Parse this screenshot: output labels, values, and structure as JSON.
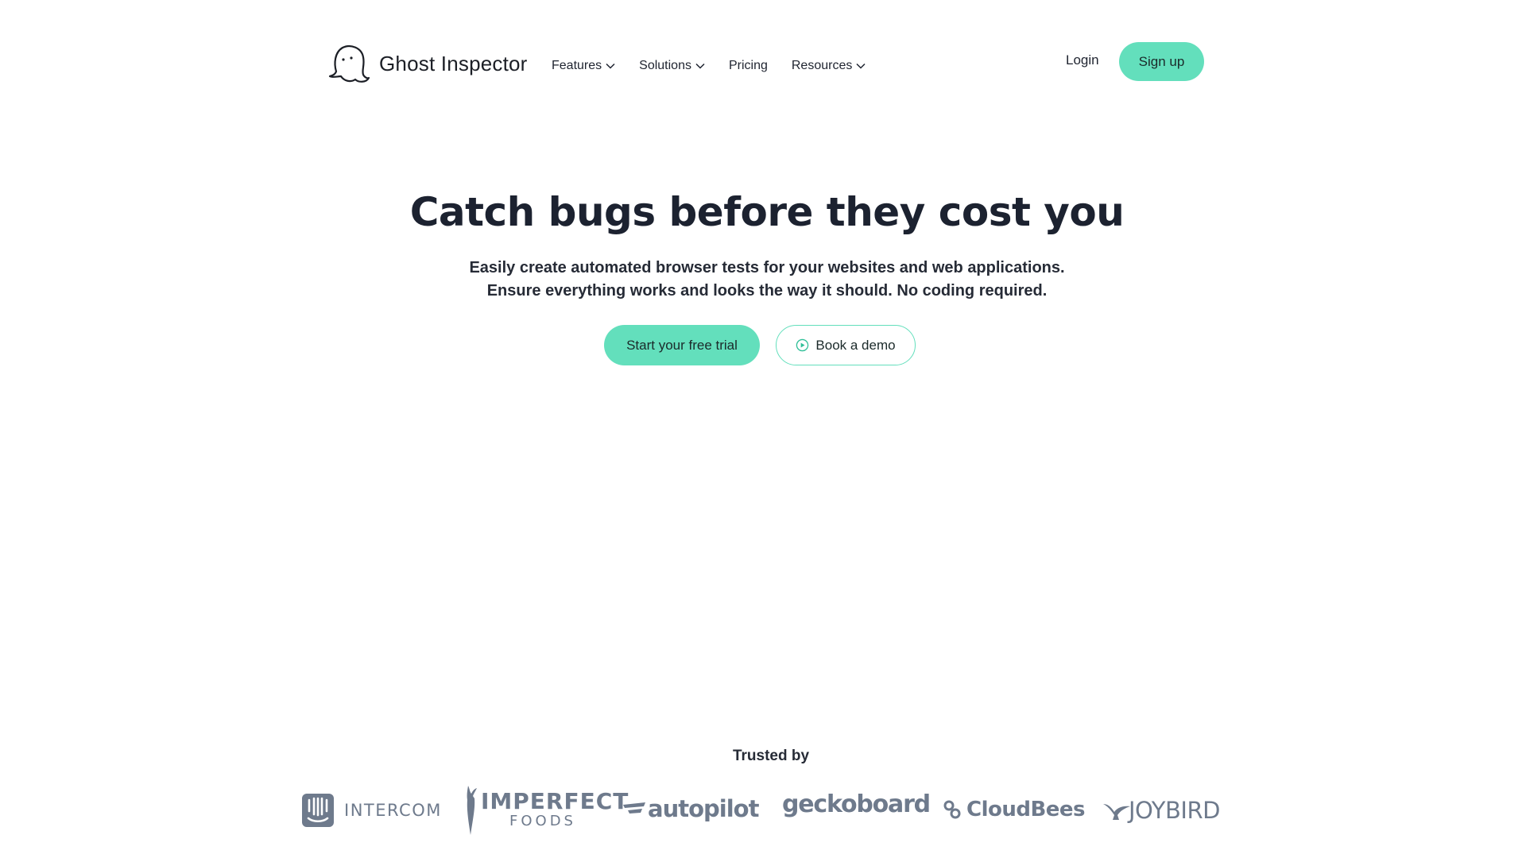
{
  "header": {
    "logo_text": "Ghost Inspector",
    "nav": [
      {
        "label": "Features",
        "has_dropdown": true
      },
      {
        "label": "Solutions",
        "has_dropdown": true
      },
      {
        "label": "Pricing",
        "has_dropdown": false
      },
      {
        "label": "Resources",
        "has_dropdown": true
      }
    ],
    "login_label": "Login",
    "signup_label": "Sign up"
  },
  "hero": {
    "title": "Catch bugs before they cost you",
    "subtitle_line1": "Easily create automated browser tests for your websites and web applications.",
    "subtitle_line2": "Ensure everything works and looks the way it should. No coding required.",
    "primary_cta": "Start your free trial",
    "secondary_cta": "Book a demo"
  },
  "trusted": {
    "heading": "Trusted by",
    "brands": [
      {
        "name": "INTERCOM",
        "icon": "intercom-logo"
      },
      {
        "name": "IMPERFECT",
        "sub": "FOODS",
        "icon": "imperfect-foods-logo"
      },
      {
        "name": "autopilot",
        "icon": "autopilot-logo"
      },
      {
        "name": "geckoboard",
        "icon": "geckoboard-logo"
      },
      {
        "name": "CloudBees",
        "icon": "cloudbees-logo"
      },
      {
        "name": "JOYBIRD",
        "icon": "joybird-logo"
      }
    ]
  },
  "colors": {
    "accent": "#63dfbc",
    "text_dark": "#1c2230",
    "brand_gray": "#6e7a8c"
  }
}
